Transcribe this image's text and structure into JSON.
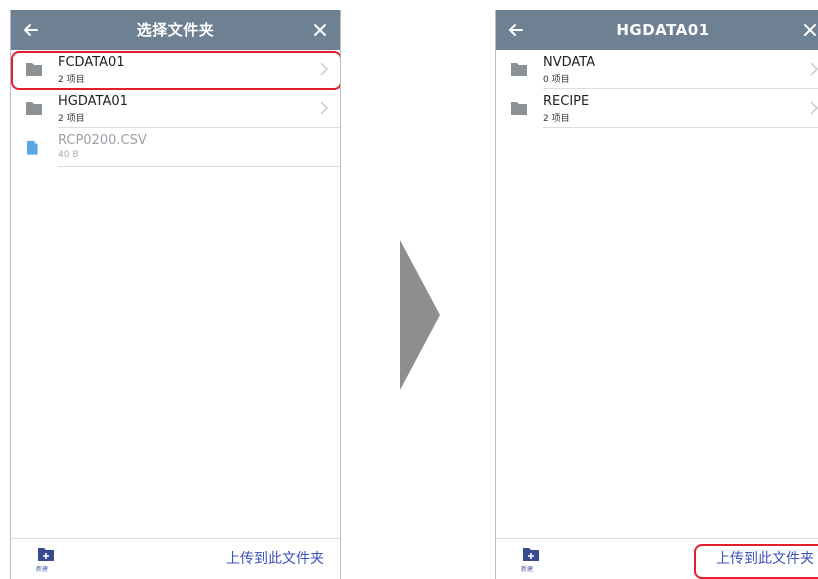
{
  "left_screen": {
    "title": "选择文件夹",
    "items": [
      {
        "name": "FCDATA01",
        "sub": "2 项目",
        "type": "folder"
      },
      {
        "name": "HGDATA01",
        "sub": "2 项目",
        "type": "folder"
      },
      {
        "name": "RCP0200.CSV",
        "sub": "40 B",
        "type": "file"
      }
    ],
    "footer": {
      "new_label": "新建",
      "upload_label": "上传到此文件夹"
    }
  },
  "right_screen": {
    "title": "HGDATA01",
    "items": [
      {
        "name": "NVDATA",
        "sub": "0 项目",
        "type": "folder"
      },
      {
        "name": "RECIPE",
        "sub": "2 项目",
        "type": "folder"
      }
    ],
    "footer": {
      "new_label": "新建",
      "upload_label": "上传到此文件夹"
    }
  },
  "colors": {
    "header": "#6d8193",
    "highlight": "#e0202a",
    "link": "#3b50b8",
    "folder_icon": "#8c9196",
    "file_icon": "#5aa9e6",
    "arrow": "#8e8e8e"
  },
  "icons": {
    "back": "arrow-left-icon",
    "close": "close-icon",
    "folder": "folder-icon",
    "file": "file-icon",
    "chevron": "chevron-right-icon",
    "new_folder": "new-folder-icon",
    "transition": "arrow-right-icon"
  }
}
